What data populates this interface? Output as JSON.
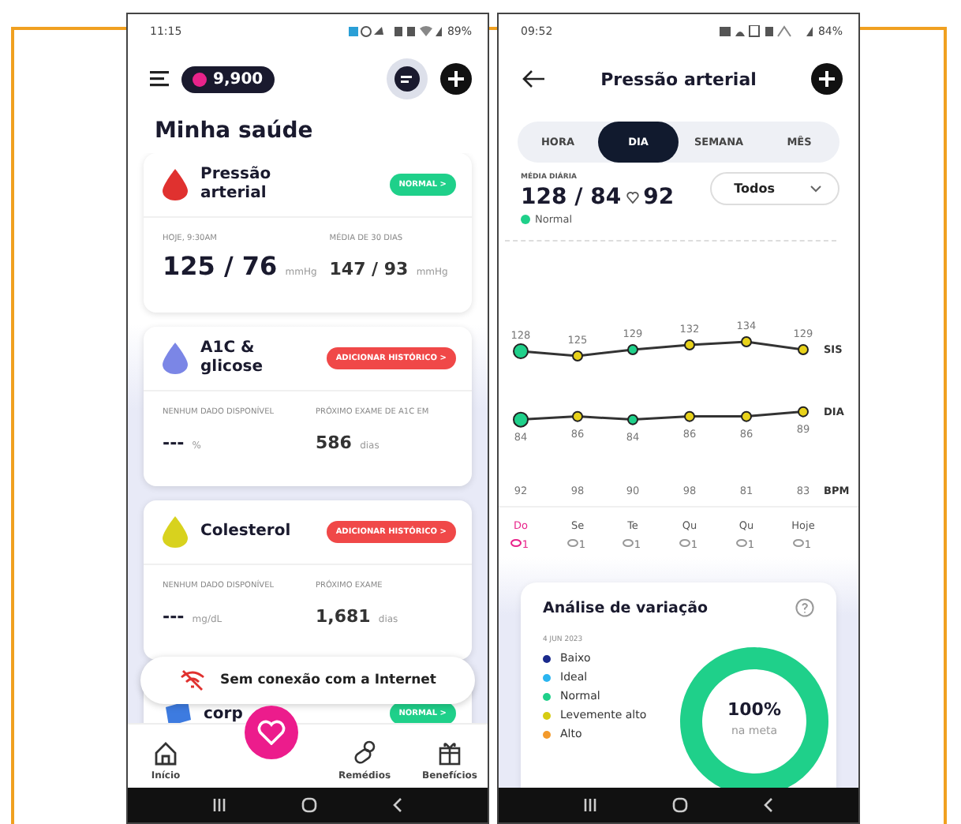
{
  "left_screen": {
    "status_bar": {
      "time": "11:15",
      "battery": "89%"
    },
    "points": "9,900",
    "title": "Minha saúde",
    "cards": [
      {
        "name": "Pressão arterial",
        "color": "#e0312f",
        "badge": {
          "label": "NORMAL >",
          "color": "#1fd08a"
        },
        "left_label": "HOJE, 9:30AM",
        "left_value": "125 / 76",
        "left_unit": "mmHg",
        "right_label": "MÉDIA DE 30 DIAS",
        "right_value": "147 / 93",
        "right_unit": "mmHg"
      },
      {
        "name": "A1C & glicose",
        "color": "#7b86e6",
        "badge": {
          "label": "ADICIONAR HISTÓRICO >",
          "color": "#f04848"
        },
        "left_label": "NENHUM DADO DISPONÍVEL",
        "left_value": "---",
        "left_unit": "%",
        "right_label": "PRÓXIMO EXAME DE A1C EM",
        "right_value": "586",
        "right_unit": "dias"
      },
      {
        "name": "Colesterol",
        "color": "#d8d21e",
        "badge": {
          "label": "ADICIONAR HISTÓRICO >",
          "color": "#f04848"
        },
        "left_label": "NENHUM DADO DISPONÍVEL",
        "left_value": "---",
        "left_unit": "mg/dL",
        "right_label": "PRÓXIMO EXAME",
        "right_value": "1,681",
        "right_unit": "dias"
      }
    ],
    "partial_card": {
      "name": "corp",
      "badge": {
        "label": "NORMAL >",
        "color": "#1fd08a"
      }
    },
    "toast": "Sem conexão com a Internet",
    "nav": [
      {
        "label": "Início",
        "kind": "home"
      },
      {
        "label": "Remédios",
        "kind": "pill"
      },
      {
        "label": "Benefícios",
        "kind": "gift"
      }
    ]
  },
  "right_screen": {
    "status_bar": {
      "time": "09:52",
      "battery": "84%"
    },
    "title": "Pressão arterial",
    "tabs": [
      {
        "label": "HORA",
        "selected": false
      },
      {
        "label": "DIA",
        "selected": true
      },
      {
        "label": "SEMANA",
        "selected": false
      },
      {
        "label": "MÊS",
        "selected": false
      }
    ],
    "summary": {
      "label": "MÉDIA DIÁRIA",
      "value": "128 / 84",
      "pulse": "92",
      "status": {
        "label": "Normal",
        "color": "#1fd08a"
      },
      "filter": "Todos"
    },
    "chart": {
      "chart_data": {
        "type": "line",
        "categories": [
          "Do",
          "Se",
          "Te",
          "Qu",
          "Qu",
          "Hoje"
        ],
        "data_labels": true,
        "series": [
          {
            "name": "SIS",
            "color": "#333333",
            "marker": true,
            "values": [
              128,
              125,
              129,
              132,
              134,
              129
            ]
          },
          {
            "name": "DIA",
            "color": "#333333",
            "marker": true,
            "values": [
              84,
              86,
              84,
              86,
              86,
              89
            ]
          }
        ]
      },
      "point_markers": [
        [
          {
            "color": "#1fd08a"
          },
          {
            "color": "#e8d21a"
          },
          {
            "color": "#1fd08a"
          },
          {
            "color": "#e8d21a"
          },
          {
            "color": "#e8d21a"
          },
          {
            "color": "#e8d21a"
          }
        ],
        [
          {
            "color": "#1fd08a"
          },
          {
            "color": "#e8d21a"
          },
          {
            "color": "#1fd08a"
          },
          {
            "color": "#e8d21a"
          },
          {
            "color": "#e8d21a"
          },
          {
            "color": "#e8d21a"
          }
        ]
      ],
      "bpm_label": "BPM",
      "bpm": [
        "92",
        "98",
        "90",
        "98",
        "81",
        "83"
      ]
    },
    "days": [
      {
        "count": "1",
        "selected": true
      },
      {
        "count": "1",
        "selected": false
      },
      {
        "count": "1",
        "selected": false
      },
      {
        "count": "1",
        "selected": false
      },
      {
        "count": "1",
        "selected": false
      },
      {
        "count": "1",
        "selected": false
      }
    ],
    "analysis": {
      "title": "Análise de variação",
      "date": "4 JUN 2023",
      "legend": [
        {
          "label": "Baixo",
          "color": "#1a2a8c"
        },
        {
          "label": "Ideal",
          "color": "#2bb5f0"
        },
        {
          "label": "Normal",
          "color": "#1fd08a"
        },
        {
          "label": "Levemente alto",
          "color": "#d6cc12"
        },
        {
          "label": "Alto",
          "color": "#f39a2b"
        }
      ],
      "donut": {
        "level": 1,
        "value": "100%",
        "caption": "na meta"
      }
    }
  }
}
